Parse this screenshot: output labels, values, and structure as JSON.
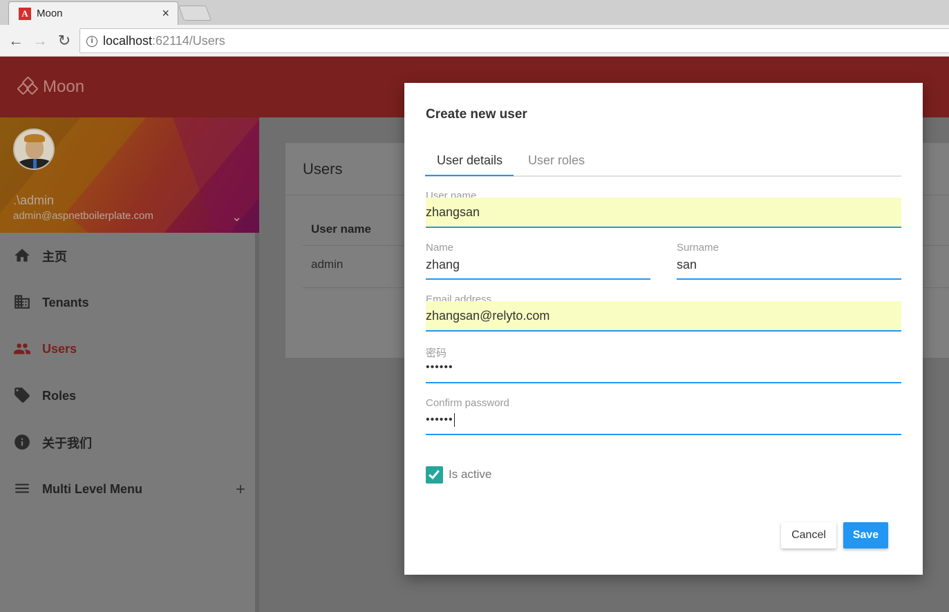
{
  "browser": {
    "tab_title": "Moon",
    "tab_close": "×",
    "favicon_letter": "A",
    "url_host": "localhost",
    "url_rest": ":62114/Users"
  },
  "app": {
    "brand": "Moon"
  },
  "profile": {
    "name": ".\\admin",
    "email": "admin@aspnetboilerplate.com"
  },
  "sidebar": {
    "items": [
      {
        "label": "主页",
        "icon": "home-icon"
      },
      {
        "label": "Tenants",
        "icon": "business-icon"
      },
      {
        "label": "Users",
        "icon": "people-icon",
        "active": true
      },
      {
        "label": "Roles",
        "icon": "tag-icon"
      },
      {
        "label": "关于我们",
        "icon": "info-icon"
      },
      {
        "label": "Multi Level Menu",
        "icon": "menu-icon"
      }
    ],
    "accent_color": "#7a201e"
  },
  "page": {
    "title": "Users",
    "table_header": "User name",
    "rows": [
      "admin"
    ]
  },
  "modal": {
    "title": "Create new user",
    "tabs": [
      "User details",
      "User roles"
    ],
    "fields": {
      "username": {
        "label": "User name",
        "value": "zhangsan"
      },
      "name": {
        "label": "Name",
        "value": "zhang"
      },
      "surname": {
        "label": "Surname",
        "value": "san"
      },
      "email": {
        "label": "Email address",
        "value": "zhangsan@relyto.com"
      },
      "password": {
        "label": "密码",
        "value": "••••••"
      },
      "confirm": {
        "label": "Confirm password",
        "value": "••••••"
      }
    },
    "is_active": {
      "label": "Is active",
      "checked": true
    },
    "buttons": {
      "cancel": "Cancel",
      "save": "Save"
    }
  },
  "colors": {
    "primary": "#2196f3",
    "checkbox": "#26a69a",
    "header": "#7a201e"
  }
}
